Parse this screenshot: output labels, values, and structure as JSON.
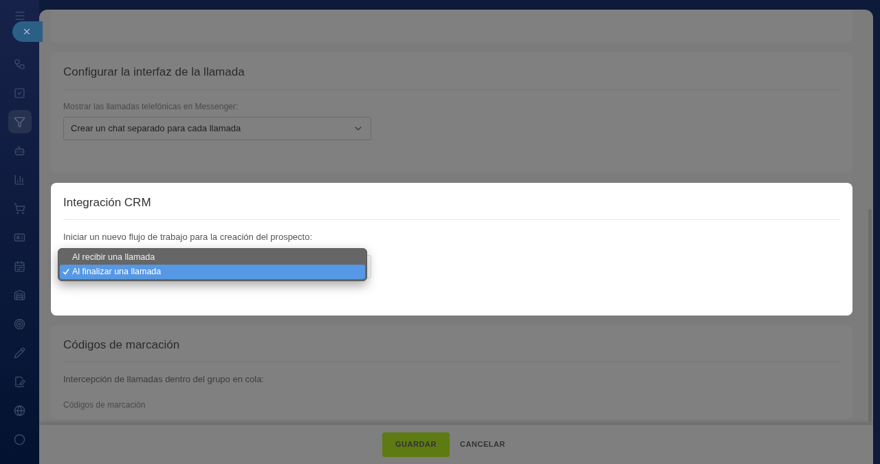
{
  "sidebar": {
    "items": [
      {
        "selected": false
      },
      {
        "selected": false
      },
      {
        "selected": true
      },
      {
        "selected": false
      },
      {
        "selected": false
      },
      {
        "selected": false
      },
      {
        "selected": false
      },
      {
        "selected": false
      },
      {
        "selected": false
      },
      {
        "selected": false
      },
      {
        "selected": false
      },
      {
        "selected": false
      },
      {
        "selected": false
      },
      {
        "selected": false
      }
    ]
  },
  "sections": [
    {
      "title": "Configurar la interfaz de la llamada",
      "highlighted": false,
      "label": "Mostrar las llamadas telefónicas en Messenger:",
      "select": {
        "value": "Crear un chat separado para cada llamada"
      }
    },
    {
      "title": "Integración CRM",
      "highlighted": true,
      "label": "Iniciar un nuevo flujo de trabajo para la creación del prospecto:",
      "menu": {
        "options": [
          {
            "label": "Al recibir una llamada",
            "selected": false
          },
          {
            "label": "Al finalizar una llamada",
            "selected": true
          }
        ]
      }
    },
    {
      "title": "Códigos de marcación",
      "highlighted": false,
      "label": "Intercepción de llamadas dentro del grupo en cola:",
      "sublabel": "Códigos de marcación"
    }
  ],
  "footer": {
    "save": "GUARDAR",
    "cancel": "CANCELAR"
  }
}
